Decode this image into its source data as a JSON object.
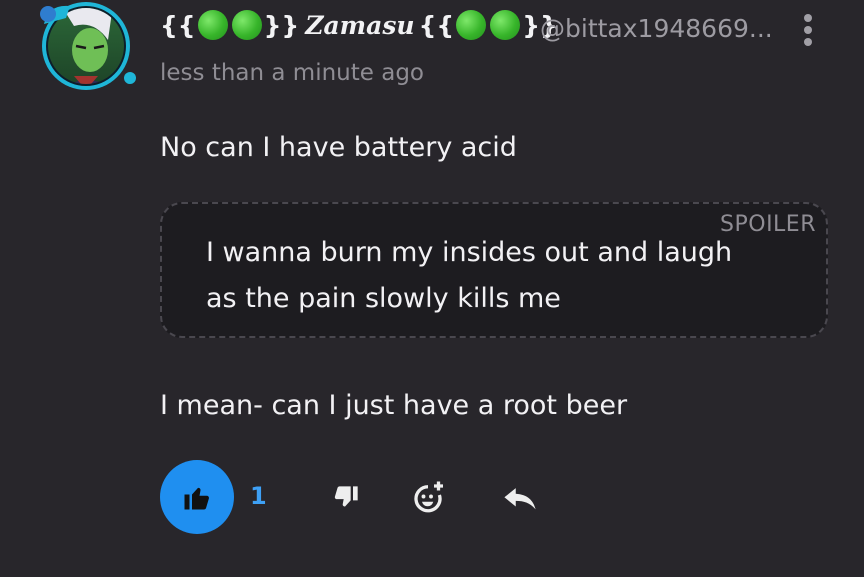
{
  "post": {
    "author_prefix": "{{",
    "author_suffix": "}}",
    "author_name": "Zamasu",
    "handle": "@bittax1948669...",
    "timestamp": "less than a minute ago",
    "line1": "No can I have battery acid",
    "spoiler_label": "SPOILER",
    "spoiler_text": "I wanna burn my insides out and laugh as the pain slowly kills me",
    "line2": "I mean- can I just have a root beer"
  },
  "actions": {
    "like_count": "1",
    "icons": [
      "thumbs-up-icon",
      "thumbs-down-icon",
      "add-reaction-icon",
      "reply-icon",
      "more-options-icon"
    ]
  },
  "colors": {
    "background": "#28262b",
    "spoiler_bg": "#1d1c20",
    "like_blue": "#1f8ff0",
    "emoji_green": "#37b52a",
    "avatar_ring": "#1fb6d8"
  }
}
